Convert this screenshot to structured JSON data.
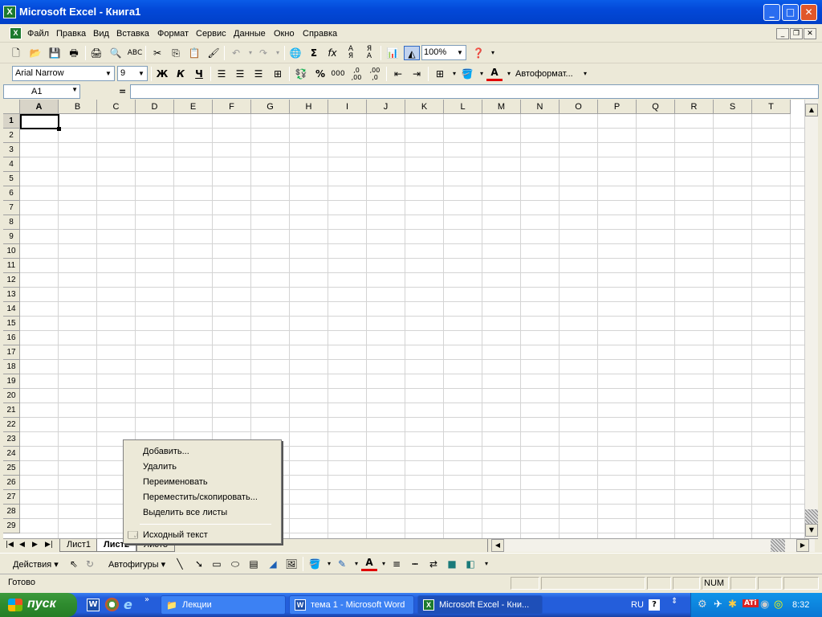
{
  "window": {
    "title": "Microsoft Excel - Книга1",
    "app_icon": "excel-icon"
  },
  "menu": {
    "items": [
      "Файл",
      "Правка",
      "Вид",
      "Вставка",
      "Формат",
      "Сервис",
      "Данные",
      "Окно",
      "Справка"
    ]
  },
  "standard_toolbar": {
    "zoom": "100%"
  },
  "format_toolbar": {
    "font": "Arial Narrow",
    "size": "9",
    "bold": "Ж",
    "italic": "К",
    "underline": "Ч",
    "autoformat": "Автоформат..."
  },
  "formula_bar": {
    "name_box": "A1",
    "equals": "="
  },
  "grid": {
    "columns": [
      "A",
      "B",
      "C",
      "D",
      "E",
      "F",
      "G",
      "H",
      "I",
      "J",
      "K",
      "L",
      "M",
      "N",
      "O",
      "P",
      "Q",
      "R",
      "S",
      "T"
    ],
    "rows": [
      "1",
      "2",
      "3",
      "4",
      "5",
      "6",
      "7",
      "8",
      "9",
      "10",
      "11",
      "12",
      "13",
      "14",
      "15",
      "16",
      "17",
      "18",
      "19",
      "20",
      "21",
      "22",
      "23",
      "24",
      "25",
      "26",
      "27",
      "28",
      "29"
    ],
    "active_cell": "A1"
  },
  "sheets": {
    "tabs": [
      "Лист1",
      "Лист2",
      "Лист3"
    ],
    "active": "Лист2"
  },
  "context_menu": {
    "items": [
      "Добавить...",
      "Удалить",
      "Переименовать",
      "Переместить/скопировать...",
      "Выделить все листы"
    ],
    "source_item": "Исходный текст"
  },
  "drawing_toolbar": {
    "actions": "Действия",
    "autoshapes": "Автофигуры"
  },
  "status": {
    "text": "Готово",
    "num": "NUM"
  },
  "taskbar": {
    "start": "пуск",
    "tasks": [
      "Лекции",
      "тема 1 - Microsoft Word",
      "Microsoft Excel - Кни..."
    ],
    "lang": "RU",
    "clock": "8:32"
  }
}
